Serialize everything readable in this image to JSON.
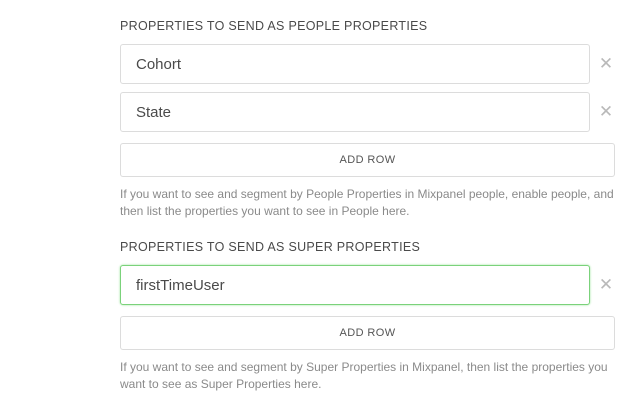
{
  "people_section": {
    "title": "PROPERTIES TO SEND AS PEOPLE PROPERTIES",
    "fields": [
      {
        "value": "Cohort"
      },
      {
        "value": "State"
      }
    ],
    "add_row_label": "ADD ROW",
    "help_text": "If you want to see and segment by People Properties in Mixpanel people, enable people, and then list the properties you want to see in People here."
  },
  "super_section": {
    "title": "PROPERTIES TO SEND AS SUPER PROPERTIES",
    "fields": [
      {
        "value": "firstTimeUser"
      }
    ],
    "add_row_label": "ADD ROW",
    "help_text": "If you want to see and segment by Super Properties in Mixpanel, then list the properties you want to see as Super Properties here."
  },
  "remove_glyph": "✕",
  "colors": {
    "focus_border": "#7bd27b",
    "border": "#dcdcdc",
    "help_text": "#8a8a8a"
  }
}
